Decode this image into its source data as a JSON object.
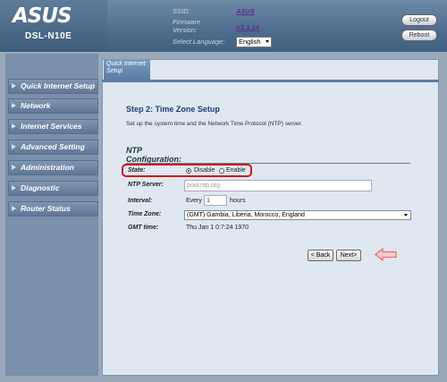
{
  "header": {
    "brand": "ASUS",
    "model": "DSL-N10E",
    "ssid_label": "SSID:",
    "ssid_value": "ASUS",
    "firmware_label": "Firmware Version:",
    "firmware_value": "V2.1.14",
    "language_label": "Select Language:",
    "language_value": "English",
    "logout_label": "Logout",
    "reboot_label": "Reboot"
  },
  "sidebar": {
    "items": [
      {
        "label": "Quick Internet Setup"
      },
      {
        "label": "Network"
      },
      {
        "label": "Internet Services"
      },
      {
        "label": "Advanced Setting"
      },
      {
        "label": "Administration"
      },
      {
        "label": "Diagnostic"
      },
      {
        "label": "Router Status"
      }
    ]
  },
  "main": {
    "tab_label": "Quick Internet Setup",
    "step_title": "Step 2: Time Zone Setup",
    "step_desc": "Set up the system time and the Network Time Protocol (NTP) server.",
    "section_title_1": "NTP",
    "section_title_2": "Configuration:",
    "state_label": "State:",
    "state_options": [
      "Disable",
      "Enable"
    ],
    "state_selected": "Disable",
    "ntp_server_label": "NTP Server:",
    "ntp_server_placeholder": "pool.ntp.org",
    "interval_label": "Interval:",
    "interval_prefix": "Every",
    "interval_value": "1",
    "interval_suffix": "hours",
    "timezone_label": "Time Zone:",
    "timezone_value": "(GMT) Gambia, Liberia, Morocco, England",
    "gmt_label": "GMT time:",
    "gmt_value": "Thu Jan 1 0:7:24 1970",
    "back_label": "< Back",
    "next_label": "Next>"
  },
  "colors": {
    "highlight": "#d0101e",
    "pointer": "#e8727a"
  }
}
